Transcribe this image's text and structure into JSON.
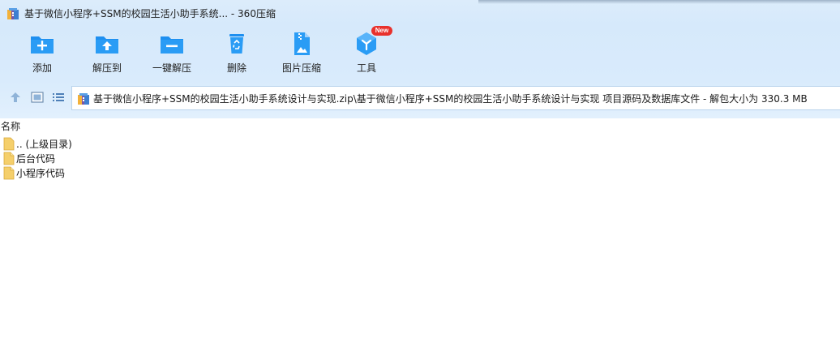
{
  "window": {
    "title": "基于微信小程序+SSM的校园生活小助手系统... - 360压缩"
  },
  "toolbar": {
    "items": [
      {
        "label": "添加",
        "icon": "add-folder-icon"
      },
      {
        "label": "解压到",
        "icon": "extract-to-icon"
      },
      {
        "label": "一键解压",
        "icon": "one-click-extract-icon"
      },
      {
        "label": "删除",
        "icon": "recycle-bin-icon"
      },
      {
        "label": "图片压缩",
        "icon": "image-compress-icon"
      },
      {
        "label": "工具",
        "icon": "tools-icon",
        "badge": "New"
      }
    ]
  },
  "address": {
    "path": "基于微信小程序+SSM的校园生活小助手系统设计与实现.zip\\基于微信小程序+SSM的校园生活小助手系统设计与实现 项目源码及数据库文件 - 解包大小为 330.3 MB"
  },
  "list": {
    "column_name": "名称",
    "rows": [
      {
        "name": ".. (上级目录)",
        "icon": "folder-icon"
      },
      {
        "name": "后台代码",
        "icon": "folder-icon"
      },
      {
        "name": "小程序代码",
        "icon": "folder-icon"
      }
    ]
  },
  "colors": {
    "accent": "#1e8ff0",
    "toolbar_bg": "#d9ebfc",
    "badge": "#e8312c",
    "folder": "#f5cf6b"
  }
}
